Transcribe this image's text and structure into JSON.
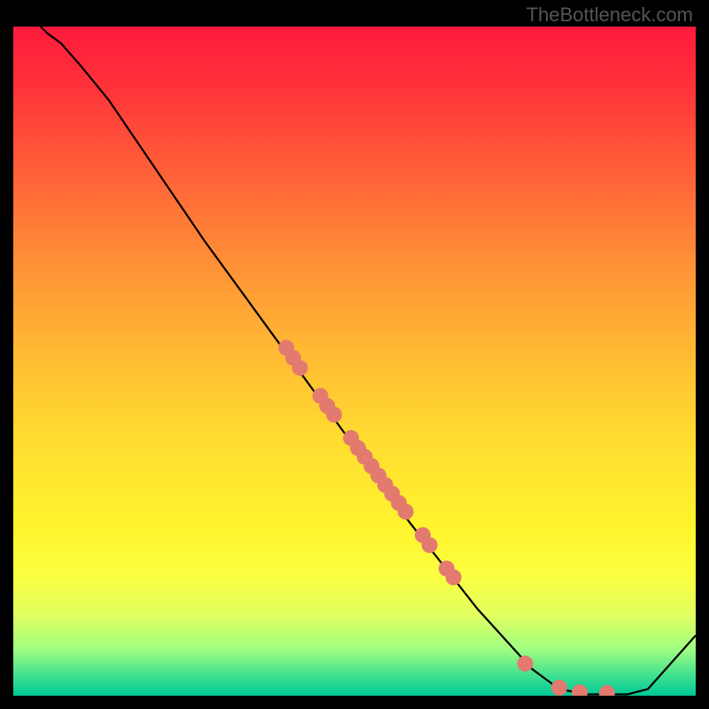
{
  "watermark": "TheBottleneck.com",
  "chart_data": {
    "type": "line",
    "title": "",
    "xlabel": "",
    "ylabel": "",
    "xlim": [
      0,
      100
    ],
    "ylim": [
      0,
      100
    ],
    "curve": [
      {
        "x": 4,
        "y": 100
      },
      {
        "x": 5,
        "y": 99
      },
      {
        "x": 7,
        "y": 97.5
      },
      {
        "x": 10,
        "y": 94
      },
      {
        "x": 14,
        "y": 89
      },
      {
        "x": 20,
        "y": 80
      },
      {
        "x": 28,
        "y": 68
      },
      {
        "x": 38,
        "y": 54
      },
      {
        "x": 48,
        "y": 40
      },
      {
        "x": 58,
        "y": 26
      },
      {
        "x": 68,
        "y": 13
      },
      {
        "x": 76,
        "y": 4
      },
      {
        "x": 80,
        "y": 1
      },
      {
        "x": 84,
        "y": 0.2
      },
      {
        "x": 90,
        "y": 0.2
      },
      {
        "x": 93,
        "y": 1
      },
      {
        "x": 100,
        "y": 9
      }
    ],
    "points": [
      {
        "x": 40,
        "y": 52
      },
      {
        "x": 41,
        "y": 50.5
      },
      {
        "x": 42,
        "y": 49
      },
      {
        "x": 45,
        "y": 44.8
      },
      {
        "x": 46,
        "y": 43.3
      },
      {
        "x": 47,
        "y": 42
      },
      {
        "x": 49.5,
        "y": 38.5
      },
      {
        "x": 50.5,
        "y": 37
      },
      {
        "x": 51.5,
        "y": 35.7
      },
      {
        "x": 52.5,
        "y": 34.3
      },
      {
        "x": 53.5,
        "y": 32.9
      },
      {
        "x": 54.5,
        "y": 31.5
      },
      {
        "x": 55.5,
        "y": 30.2
      },
      {
        "x": 56.5,
        "y": 28.8
      },
      {
        "x": 57.5,
        "y": 27.5
      },
      {
        "x": 60,
        "y": 24
      },
      {
        "x": 61,
        "y": 22.5
      },
      {
        "x": 63.5,
        "y": 19
      },
      {
        "x": 64.5,
        "y": 17.7
      },
      {
        "x": 75,
        "y": 4.8
      },
      {
        "x": 80,
        "y": 1.2
      },
      {
        "x": 83,
        "y": 0.5
      },
      {
        "x": 87,
        "y": 0.4
      }
    ],
    "point_color": "#e37a6f",
    "point_radius": 9
  }
}
